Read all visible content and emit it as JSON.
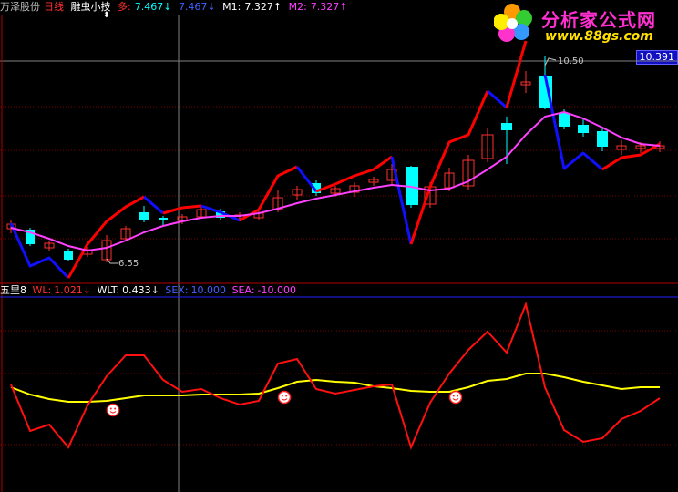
{
  "header": {
    "stock_name": "万泽股份",
    "period": "日线",
    "indicator_name": "雕虫小技",
    "duo_label": "多:",
    "duo_value": "7.467↓",
    "blue_value": "7.467↓",
    "m1_label": "M1:",
    "m1_value": "7.327↑",
    "m2_label": "M2:",
    "m2_value": "7.327↑",
    "cursor_mark": "⬍"
  },
  "logo": {
    "name": "分析家公式网",
    "url": "www.88gs.com"
  },
  "price_tag": "10.391",
  "annotations": {
    "high": "10.50",
    "low": "6.55"
  },
  "sub_panel": {
    "name": "五里8",
    "wl_label": "WL:",
    "wl_value": "1.021↓",
    "wlt_label": "WLT:",
    "wlt_value": "0.433↓",
    "sex_label": "SEX:",
    "sex_value": "10.000",
    "sea_label": "SEA:",
    "sea_value": "-10.000"
  },
  "colors": {
    "up_candle": "#ff3030",
    "down_candle": "#00ffff",
    "line_up": "#ff0000",
    "line_down": "#1010ff",
    "ma_line": "#ff40ff",
    "wlt_line": "#ffff00",
    "wl_line": "#ff1010",
    "smiley": "#ff2020"
  },
  "icons": {
    "logo": "pinwheel-logo-icon",
    "smiley": "smiley-icon"
  }
}
